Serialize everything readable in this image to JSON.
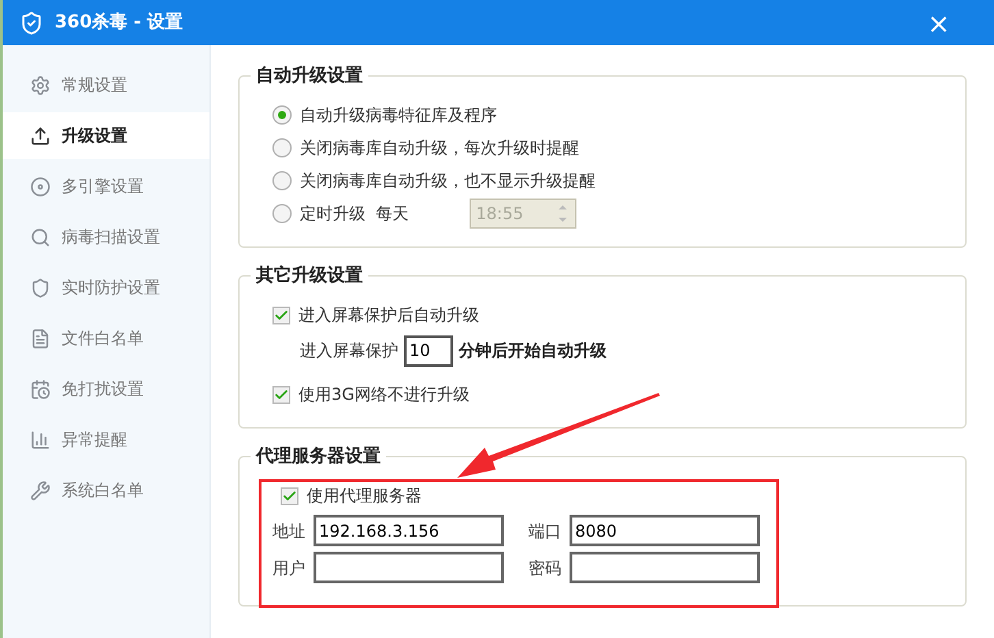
{
  "window": {
    "title": "360杀毒 - 设置",
    "close": "×"
  },
  "sidebar": {
    "items": [
      {
        "label": "常规设置",
        "selected": false
      },
      {
        "label": "升级设置",
        "selected": true
      },
      {
        "label": "多引擎设置",
        "selected": false
      },
      {
        "label": "病毒扫描设置",
        "selected": false
      },
      {
        "label": "实时防护设置",
        "selected": false
      },
      {
        "label": "文件白名单",
        "selected": false
      },
      {
        "label": "免打扰设置",
        "selected": false
      },
      {
        "label": "异常提醒",
        "selected": false
      },
      {
        "label": "系统白名单",
        "selected": false
      }
    ]
  },
  "auto_upgrade": {
    "title": "自动升级设置",
    "options": [
      {
        "label": "自动升级病毒特征库及程序",
        "selected": true
      },
      {
        "label": "关闭病毒库自动升级，每次升级时提醒",
        "selected": false
      },
      {
        "label": "关闭病毒库自动升级，也不显示升级提醒",
        "selected": false
      },
      {
        "label": "定时升级  每天",
        "selected": false
      }
    ],
    "time": {
      "value": "18:55",
      "disabled": true
    }
  },
  "other_upgrade": {
    "title": "其它升级设置",
    "screensaver": {
      "label": "进入屏幕保护后自动升级",
      "checked": true
    },
    "delay_prefix": "进入屏幕保护",
    "delay_value": "10",
    "delay_suffix": "分钟后开始自动升级",
    "no_3g": {
      "label": "使用3G网络不进行升级",
      "checked": true
    }
  },
  "proxy": {
    "title": "代理服务器设置",
    "use_proxy": {
      "label": "使用代理服务器",
      "checked": true
    },
    "fields": [
      {
        "label": "地址",
        "value": "192.168.3.156"
      },
      {
        "label": "端口",
        "value": "8080"
      },
      {
        "label": "用户"
      },
      {
        "label": "密码"
      }
    ]
  }
}
